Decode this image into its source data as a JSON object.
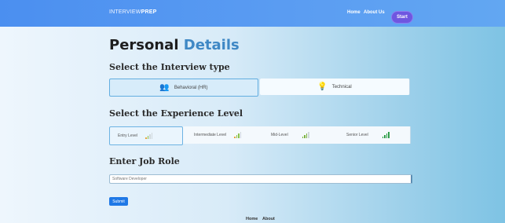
{
  "navbar": {
    "brand_light": "INTERVIEW",
    "brand_bold": "PREP",
    "links": [
      "Home",
      "About Us"
    ],
    "start_label": "Start"
  },
  "title": {
    "part1": "Personal",
    "part2": "Details"
  },
  "interview_type": {
    "heading": "Select the Interview type",
    "options": [
      {
        "label": "Behavioral (HR)",
        "selected": true
      },
      {
        "label": "Technical",
        "selected": false
      }
    ]
  },
  "experience": {
    "heading": "Select the Experience Level",
    "levels": [
      {
        "label": "Entry Level",
        "selected": true
      },
      {
        "label": "Intermediate Level",
        "selected": false
      },
      {
        "label": "Mid-Level",
        "selected": false
      },
      {
        "label": "Senior Level",
        "selected": false
      }
    ]
  },
  "job_role": {
    "heading": "Enter Job Role",
    "value": "Software Developer"
  },
  "submit_label": "Submit",
  "footer": {
    "links": [
      "Home",
      "About"
    ]
  },
  "colors": {
    "accent": "#3f88c5",
    "nav": "#4b8ff0",
    "start": "#6f56e0",
    "submit": "#1f78e6"
  }
}
